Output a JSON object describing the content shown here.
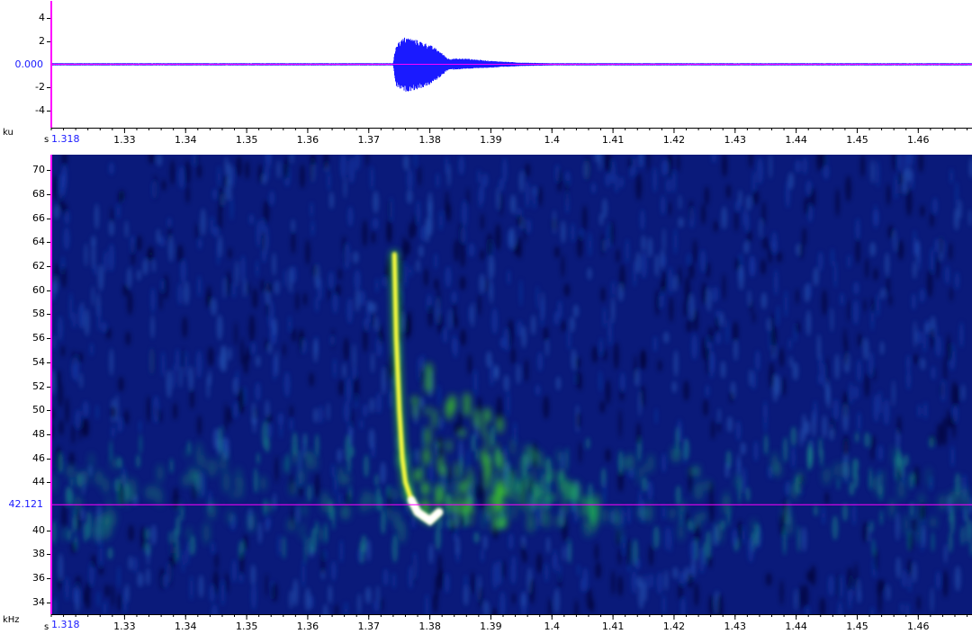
{
  "waveform": {
    "unit_label": "ku",
    "x_unit_label": "s",
    "cursor_value": "0.000",
    "y_ticks": [
      "4",
      "2",
      "-2",
      "-4"
    ],
    "y_tick_values": [
      4,
      2,
      -2,
      -4
    ],
    "ylim": [
      -5.5,
      5.5
    ]
  },
  "spectrogram": {
    "unit_label": "kHz",
    "x_unit_label": "s",
    "cursor_value": "42.121",
    "y_ticks": [
      "70",
      "68",
      "66",
      "64",
      "62",
      "60",
      "58",
      "56",
      "54",
      "52",
      "50",
      "48",
      "46",
      "44",
      "40",
      "38",
      "36",
      "34"
    ],
    "y_tick_values": [
      70,
      68,
      66,
      64,
      62,
      60,
      58,
      56,
      54,
      52,
      50,
      48,
      46,
      44,
      40,
      38,
      36,
      34
    ],
    "ylim": [
      33.0,
      71.3
    ]
  },
  "x_axis": {
    "start_label": "1.318",
    "ticks": [
      "1.33",
      "1.34",
      "1.35",
      "1.36",
      "1.37",
      "1.38",
      "1.39",
      "1.4",
      "1.41",
      "1.42",
      "1.43",
      "1.44",
      "1.45",
      "1.46"
    ],
    "tick_values": [
      1.33,
      1.34,
      1.35,
      1.36,
      1.37,
      1.38,
      1.39,
      1.4,
      1.41,
      1.42,
      1.43,
      1.44,
      1.45,
      1.46
    ],
    "xlim": [
      1.318,
      1.4688
    ]
  },
  "colors": {
    "waveform": "#1a1aff",
    "cursor": "#ff00ff",
    "spec_background": "#0a1a7a",
    "spec_mid": "#00c060",
    "spec_high": "#ffff40",
    "spec_peak": "#ffffff"
  },
  "chart_data": [
    {
      "type": "line",
      "title": "",
      "ylabel": "ku",
      "xlabel": "s",
      "xlim": [
        1.318,
        1.4688
      ],
      "ylim": [
        -5.5,
        5.5
      ],
      "series": [
        {
          "x": [
            1.318,
            1.374,
            1.3745,
            1.376,
            1.378,
            1.38,
            1.3815,
            1.383,
            1.386,
            1.39,
            1.395,
            1.4,
            1.4688
          ],
          "y_max": [
            0.1,
            0.1,
            1.8,
            2.4,
            2.1,
            1.7,
            1.2,
            0.5,
            0.5,
            0.3,
            0.15,
            0.1,
            0.1
          ],
          "y_min": [
            -0.1,
            -0.1,
            -2.0,
            -2.4,
            -2.2,
            -1.8,
            -1.2,
            -0.5,
            -0.4,
            -0.3,
            -0.15,
            -0.1,
            -0.1
          ]
        }
      ]
    },
    {
      "type": "heatmap",
      "title": "",
      "ylabel": "kHz",
      "xlabel": "s",
      "xlim": [
        1.318,
        1.4688
      ],
      "ylim": [
        33.0,
        71.3
      ],
      "call_contour": {
        "x": [
          1.3742,
          1.3745,
          1.375,
          1.3755,
          1.376,
          1.377,
          1.378,
          1.38,
          1.3815
        ],
        "y": [
          63.0,
          56.0,
          50.0,
          46.0,
          44.0,
          42.5,
          41.5,
          40.8,
          41.5
        ]
      }
    }
  ]
}
